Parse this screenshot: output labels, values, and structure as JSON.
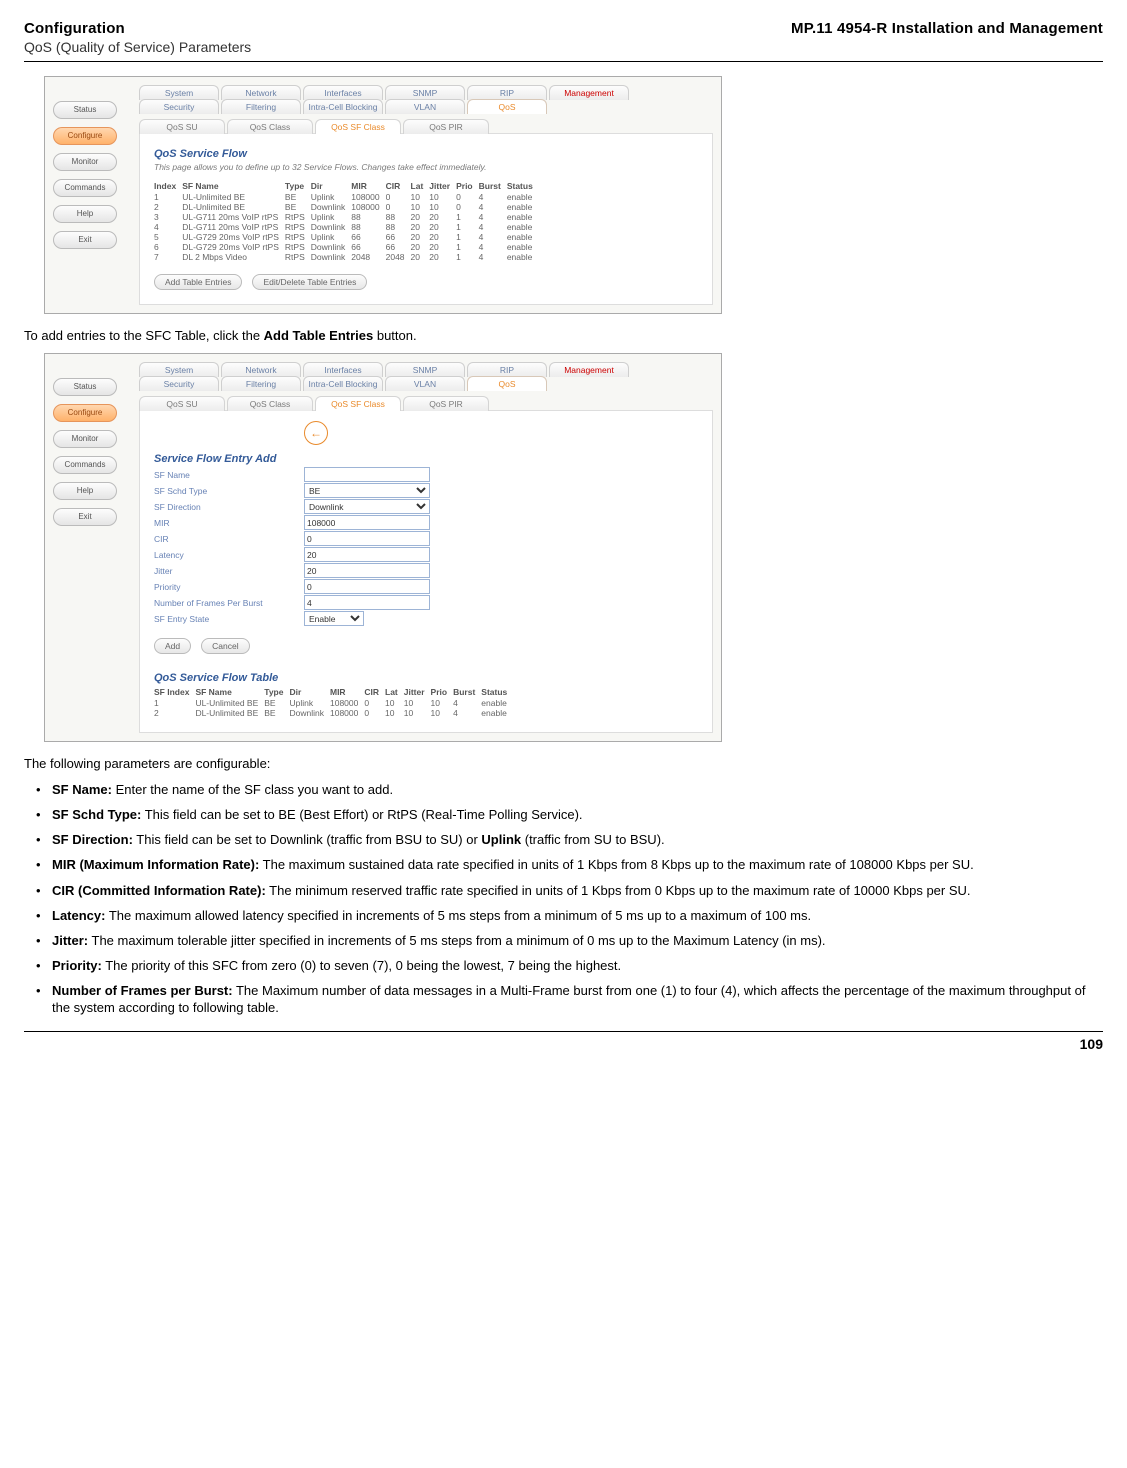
{
  "header": {
    "left_title": "Configuration",
    "left_sub": "QoS (Quality of Service) Parameters",
    "right_title": "MP.11 4954-R Installation and Management"
  },
  "sidebar_buttons": [
    "Status",
    "Configure",
    "Monitor",
    "Commands",
    "Help",
    "Exit"
  ],
  "tabs_row1": [
    "System",
    "Network",
    "Interfaces",
    "SNMP",
    "RIP",
    "Management"
  ],
  "tabs_row2": [
    "Security",
    "Filtering",
    "Intra-Cell Blocking",
    "VLAN",
    "QoS"
  ],
  "subtabs": [
    "QoS SU",
    "QoS Class",
    "QoS SF Class",
    "QoS PIR"
  ],
  "shot1": {
    "title": "QoS Service Flow",
    "subtitle": "This page allows you to define up to 32 Service Flows. Changes take effect immediately.",
    "cols": [
      "Index",
      "SF Name",
      "Type",
      "Dir",
      "MIR",
      "CIR",
      "Lat",
      "Jitter",
      "Prio",
      "Burst",
      "Status"
    ],
    "rows": [
      [
        "1",
        "UL-Unlimited BE",
        "BE",
        "Uplink",
        "108000",
        "0",
        "10",
        "10",
        "0",
        "4",
        "enable"
      ],
      [
        "2",
        "DL-Unlimited BE",
        "BE",
        "Downlink",
        "108000",
        "0",
        "10",
        "10",
        "0",
        "4",
        "enable"
      ],
      [
        "3",
        "UL-G711 20ms VoIP rtPS",
        "RtPS",
        "Uplink",
        "88",
        "88",
        "20",
        "20",
        "1",
        "4",
        "enable"
      ],
      [
        "4",
        "DL-G711 20ms VoIP rtPS",
        "RtPS",
        "Downlink",
        "88",
        "88",
        "20",
        "20",
        "1",
        "4",
        "enable"
      ],
      [
        "5",
        "UL-G729 20ms VoIP rtPS",
        "RtPS",
        "Uplink",
        "66",
        "66",
        "20",
        "20",
        "1",
        "4",
        "enable"
      ],
      [
        "6",
        "DL-G729 20ms VoIP rtPS",
        "RtPS",
        "Downlink",
        "66",
        "66",
        "20",
        "20",
        "1",
        "4",
        "enable"
      ],
      [
        "7",
        "DL 2 Mbps Video",
        "RtPS",
        "Downlink",
        "2048",
        "2048",
        "20",
        "20",
        "1",
        "4",
        "enable"
      ]
    ],
    "btn_add": "Add Table Entries",
    "btn_edit": "Edit/Delete Table Entries"
  },
  "text_between": "To add entries to the SFC Table, click the ",
  "text_between_bold": "Add Table Entries",
  "text_between_after": " button.",
  "shot2": {
    "form_title": "Service Flow Entry Add",
    "fields": {
      "sf_name_label": "SF Name",
      "sf_schd_label": "SF Schd Type",
      "sf_schd_value": "BE",
      "sf_dir_label": "SF Direction",
      "sf_dir_value": "Downlink",
      "mir_label": "MIR",
      "mir_value": "108000",
      "cir_label": "CIR",
      "cir_value": "0",
      "latency_label": "Latency",
      "latency_value": "20",
      "jitter_label": "Jitter",
      "jitter_value": "20",
      "priority_label": "Priority",
      "priority_value": "0",
      "frames_label": "Number of Frames Per Burst",
      "frames_value": "4",
      "state_label": "SF Entry State",
      "state_value": "Enable"
    },
    "btn_add": "Add",
    "btn_cancel": "Cancel",
    "table_title": "QoS Service Flow Table",
    "cols": [
      "SF Index",
      "SF Name",
      "Type",
      "Dir",
      "MIR",
      "CIR",
      "Lat",
      "Jitter",
      "Prio",
      "Burst",
      "Status"
    ],
    "rows": [
      [
        "1",
        "UL-Unlimited BE",
        "BE",
        "Uplink",
        "108000",
        "0",
        "10",
        "10",
        "10",
        "4",
        "enable"
      ],
      [
        "2",
        "DL-Unlimited BE",
        "BE",
        "Downlink",
        "108000",
        "0",
        "10",
        "10",
        "10",
        "4",
        "enable"
      ]
    ]
  },
  "text_after": "The following parameters are configurable:",
  "params": [
    {
      "b": "SF Name:",
      "t": " Enter the name of the SF class you want to add."
    },
    {
      "b": "SF Schd Type:",
      "t": " This field can be set to BE (Best Effort) or RtPS (Real-Time Polling Service)."
    },
    {
      "b": "SF Direction:",
      "t": " This field can be set to Downlink (traffic from BSU to SU) or ",
      "b2": "Uplink",
      "t2": " (traffic from SU to BSU)."
    },
    {
      "b": "MIR (Maximum Information Rate):",
      "t": " The maximum sustained data rate specified in units of 1 Kbps from 8 Kbps up to the maximum rate of 108000 Kbps per SU."
    },
    {
      "b": "CIR (Committed Information Rate):",
      "t": " The minimum reserved traffic rate specified in units of 1 Kbps from 0 Kbps up to the maximum rate of 10000 Kbps per SU."
    },
    {
      "b": "Latency:",
      "t": " The maximum allowed latency specified in increments of 5 ms steps from a minimum of 5 ms up to a maximum of 100 ms."
    },
    {
      "b": "Jitter:",
      "t": " The maximum tolerable jitter specified in increments of 5 ms steps from a minimum of 0 ms up to the Maximum Latency (in ms)."
    },
    {
      "b": "Priority:",
      "t": " The priority of this SFC from zero (0) to seven (7), 0 being the lowest, 7 being the highest."
    },
    {
      "b": "Number of Frames per Burst:",
      "t": " The Maximum number of data messages in a Multi-Frame burst from one (1) to four (4), which affects the percentage of the maximum throughput of the system according to following table."
    }
  ],
  "page_number": "109"
}
